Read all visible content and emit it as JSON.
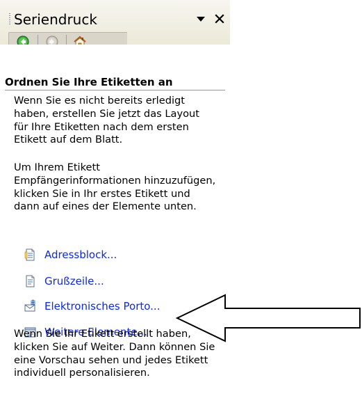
{
  "pane": {
    "title": "Seriendruck"
  },
  "section": {
    "title": "Ordnen Sie Ihre Etiketten an"
  },
  "paragraphs": [
    "Wenn Sie es nicht bereits erledigt haben, erstellen Sie jetzt das Layout für Ihre Etiketten nach dem ersten Etikett auf dem Blatt.",
    "Um Ihrem Etikett Empfängerinformationen hinzuzufügen, klicken Sie in Ihr erstes Etikett und dann auf eines der Elemente unten.",
    "Wenn Sie Ihr Etikett erstellt haben, klicken Sie auf Weiter. Dann können Sie eine Vorschau sehen und jedes Etikett individuell personalisieren."
  ],
  "links": [
    {
      "label": "Adressblock...",
      "icon": "address-block-icon"
    },
    {
      "label": "Grußzeile...",
      "icon": "greeting-line-icon"
    },
    {
      "label": "Elektronisches Porto...",
      "icon": "electronic-postage-icon"
    },
    {
      "label": "Weitere Elemente...",
      "icon": "more-items-icon"
    }
  ],
  "colors": {
    "link": "#0a28f0",
    "section_rule": "#7f9db9",
    "toolbar": "#d9d5c9",
    "header": "#ece9d8",
    "nav_green": "#37a22f",
    "home_orange": "#e47a12"
  },
  "icons": {
    "pane_menu": "triangle-down-icon",
    "pane_close": "close-icon",
    "back": "back-arrow-icon",
    "forward": "forward-arrow-icon",
    "home": "home-icon",
    "annotation": "annotation-arrow"
  }
}
